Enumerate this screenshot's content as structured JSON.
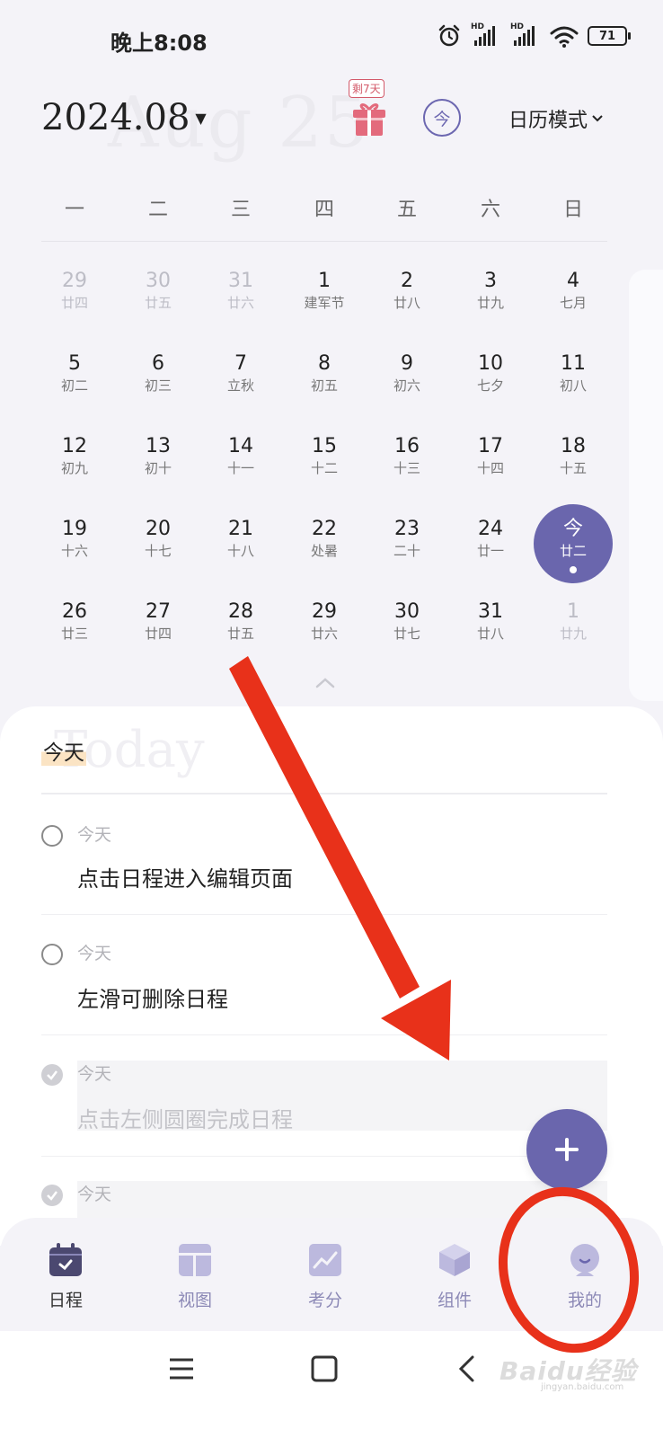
{
  "status_bar": {
    "time": "晚上8:08",
    "hd1": "HD",
    "hd2": "HD",
    "battery": "71",
    "icons": [
      "alarm-icon",
      "signal-icon",
      "signal-icon",
      "wifi-icon",
      "battery-icon"
    ]
  },
  "header": {
    "month_title": "2024.08",
    "ghost_text": "Aug 25",
    "gift_badge": "剩7天",
    "today_button": "今",
    "mode_button": "日历模式"
  },
  "calendar": {
    "weekdays": [
      "一",
      "二",
      "三",
      "四",
      "五",
      "六",
      "日"
    ],
    "weeks": [
      [
        {
          "n": "29",
          "l": "廿四",
          "o": true
        },
        {
          "n": "30",
          "l": "廿五",
          "o": true
        },
        {
          "n": "31",
          "l": "廿六",
          "o": true
        },
        {
          "n": "1",
          "l": "建军节"
        },
        {
          "n": "2",
          "l": "廿八"
        },
        {
          "n": "3",
          "l": "廿九"
        },
        {
          "n": "4",
          "l": "七月"
        }
      ],
      [
        {
          "n": "5",
          "l": "初二"
        },
        {
          "n": "6",
          "l": "初三"
        },
        {
          "n": "7",
          "l": "立秋"
        },
        {
          "n": "8",
          "l": "初五"
        },
        {
          "n": "9",
          "l": "初六"
        },
        {
          "n": "10",
          "l": "七夕"
        },
        {
          "n": "11",
          "l": "初八"
        }
      ],
      [
        {
          "n": "12",
          "l": "初九"
        },
        {
          "n": "13",
          "l": "初十"
        },
        {
          "n": "14",
          "l": "十一"
        },
        {
          "n": "15",
          "l": "十二"
        },
        {
          "n": "16",
          "l": "十三"
        },
        {
          "n": "17",
          "l": "十四"
        },
        {
          "n": "18",
          "l": "十五"
        }
      ],
      [
        {
          "n": "19",
          "l": "十六"
        },
        {
          "n": "20",
          "l": "十七"
        },
        {
          "n": "21",
          "l": "十八"
        },
        {
          "n": "22",
          "l": "处暑"
        },
        {
          "n": "23",
          "l": "二十"
        },
        {
          "n": "24",
          "l": "廿一"
        },
        {
          "n": "今",
          "l": "廿二",
          "t": true
        }
      ],
      [
        {
          "n": "26",
          "l": "廿三"
        },
        {
          "n": "27",
          "l": "廿四"
        },
        {
          "n": "28",
          "l": "廿五"
        },
        {
          "n": "29",
          "l": "廿六"
        },
        {
          "n": "30",
          "l": "廿七"
        },
        {
          "n": "31",
          "l": "廿八"
        },
        {
          "n": "1",
          "l": "廿九",
          "o": true
        }
      ]
    ]
  },
  "tasks": {
    "section_title": "今天",
    "ghost_text": "Today",
    "items": [
      {
        "date": "今天",
        "title": "点击日程进入编辑页面",
        "done": false
      },
      {
        "date": "今天",
        "title": "左滑可删除日程",
        "done": false
      },
      {
        "date": "今天",
        "title": "点击左侧圆圈完成日程",
        "done": true
      },
      {
        "date": "今天",
        "title": "",
        "done": true
      }
    ]
  },
  "bottom_nav": {
    "items": [
      {
        "label": "日程",
        "icon": "calendar-icon",
        "active": true
      },
      {
        "label": "视图",
        "icon": "view-icon",
        "active": false
      },
      {
        "label": "考分",
        "icon": "chart-icon",
        "active": false
      },
      {
        "label": "组件",
        "icon": "cube-icon",
        "active": false
      },
      {
        "label": "我的",
        "icon": "profile-icon",
        "active": false
      }
    ]
  },
  "watermark": {
    "text": "Baidu经验",
    "sub": "jingyan.baidu.com"
  },
  "colors": {
    "accent": "#6a66ad",
    "annotation_red": "#e8311a",
    "highlight": "#fbe4c4"
  }
}
